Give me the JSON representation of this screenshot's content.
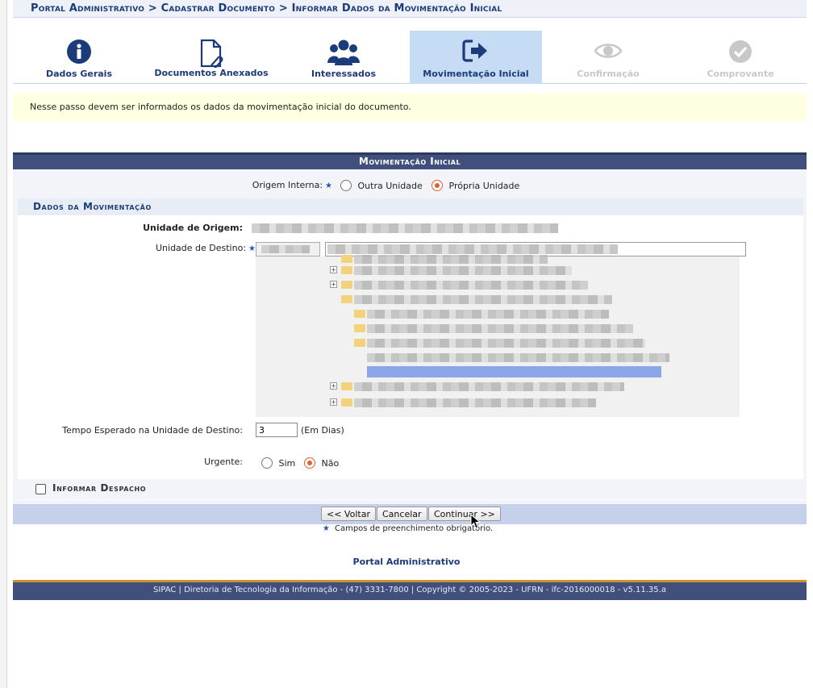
{
  "breadcrumb": "Portal Administrativo > Cadastrar Documento > Informar Dados da Movimentação Inicial",
  "steps": [
    {
      "label": "Dados Gerais",
      "icon": "info-icon",
      "state": "done"
    },
    {
      "label": "Documentos Anexados",
      "icon": "document-attachment-icon",
      "state": "done"
    },
    {
      "label": "Interessados",
      "icon": "users-icon",
      "state": "done"
    },
    {
      "label": "Movimentação Inicial",
      "icon": "sign-out-arrow-icon",
      "state": "active"
    },
    {
      "label": "Confirmação",
      "icon": "eye-icon",
      "state": "disabled"
    },
    {
      "label": "Comprovante",
      "icon": "check-circle-icon",
      "state": "disabled"
    }
  ],
  "info": "Nesse passo devem ser informados os dados da movimentação inicial do documento.",
  "panel": {
    "title": "Movimentação Inicial",
    "origem_label": "Origem Interna:",
    "origem_options": [
      "Outra Unidade",
      "Própria Unidade"
    ],
    "origem_selected": "Própria Unidade",
    "section_title": "Dados da Movimentação",
    "unidade_origem_label": "Unidade de Origem:",
    "unidade_destino_label": "Unidade de Destino:",
    "tempo_label": "Tempo Esperado na Unidade de Destino:",
    "tempo_value": "3",
    "tempo_unit": "(Em Dias)",
    "urgente_label": "Urgente:",
    "urgente_options": [
      "Sim",
      "Não"
    ],
    "urgente_selected": "Não",
    "despacho_label": "Informar Despacho"
  },
  "buttons": {
    "back": "<< Voltar",
    "cancel": "Cancelar",
    "continue": "Continuar >>"
  },
  "required_note": "Campos de preenchimento obrigatório.",
  "footer_link": "Portal Administrativo",
  "footer_text": "SIPAC | Diretoria de Tecnologia da Informação - (47) 3331-7800 | Copyright © 2005-2023 - UFRN - ifc-2016000018 - v5.11.35.a",
  "colors": {
    "primary": "#1c3b7a",
    "header_bar": "#404f7c",
    "active_step": "#c5dcf4",
    "radio_selected": "#e2622e",
    "info_bg": "#ffffe1"
  }
}
